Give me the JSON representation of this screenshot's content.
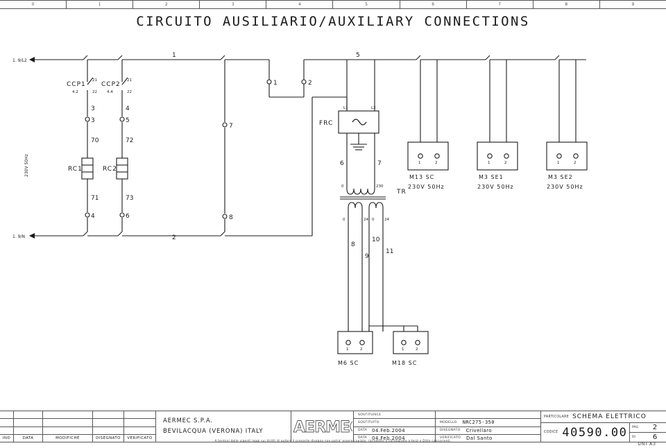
{
  "ruler": {
    "marks": [
      "0",
      "1",
      "2",
      "3",
      "4",
      "5",
      "6",
      "7",
      "8",
      "9"
    ]
  },
  "title": "CIRCUITO AUSILIARIO/AUXILIARY CONNECTIONS",
  "supply": {
    "top_rail_label": "1. 9/L2",
    "bottom_rail_label": "1. 9/N",
    "voltage_label": "230V 50Hz"
  },
  "wires": {
    "top_rail_1": "1",
    "top_rail_5": "5",
    "bottom_rail_2": "2",
    "w3_upper": "3",
    "w3_lower": "3",
    "w4_upper": "4",
    "w5_lower": "5",
    "w70": "70",
    "w72": "72",
    "w71": "71",
    "w73": "73",
    "w4_bottom": "4",
    "w6_bottom": "6",
    "w7_mid": "7",
    "w8_mid": "8",
    "w1_term": "1",
    "w2_term": "2",
    "w6_pri": "6",
    "w7_pri": "7",
    "w8_sec": "8",
    "w9_sec": "9",
    "w10_sec": "10",
    "w11_sec": "11"
  },
  "contactors": [
    {
      "name": "CCP1",
      "ref": "4.2",
      "terminal_top": "21",
      "terminal_bottom": "22"
    },
    {
      "name": "CCP2",
      "ref": "4.4",
      "terminal_top": "21",
      "terminal_bottom": "22"
    }
  ],
  "resistors": [
    {
      "name": "RC1"
    },
    {
      "name": "RC2"
    }
  ],
  "filter": {
    "name": "FRC",
    "input_left": "L1",
    "input_right": "L2"
  },
  "transformer": {
    "name": "TR",
    "primary_left": "0",
    "primary_right": "230",
    "secondary1_left": "0",
    "secondary1_right": "24",
    "secondary2_left": "0",
    "secondary2_right": "24"
  },
  "terminal_blocks": [
    {
      "name": "M13 SC",
      "rating": "230V 50Hz",
      "pins": [
        "1",
        "2"
      ]
    },
    {
      "name": "M3 SE1",
      "rating": "230V 50Hz",
      "pins": [
        "1",
        "2"
      ]
    },
    {
      "name": "M3 SE2",
      "rating": "230V 50Hz",
      "pins": [
        "1",
        "2"
      ]
    },
    {
      "name": "M6 SC",
      "rating": "",
      "pins": [
        "1",
        "2"
      ]
    },
    {
      "name": "M18 SC",
      "rating": "",
      "pins": [
        "1",
        "2"
      ]
    }
  ],
  "title_block": {
    "revision_headers": [
      "IND",
      "DATA",
      "MODIFICHE",
      "DISEGNATO",
      "VERIFICATO"
    ],
    "company_name": "AERMEC S.P.A.",
    "company_address": "BEVILACQUA (VERONA) ITALY",
    "logo_text": "AERMEC",
    "replaces_label": "SOSTITUISCE",
    "replaces_value": "",
    "replaced_label": "SOSTITUITO",
    "replaced_value": "",
    "model_label": "MODELLO",
    "model_value": "NRC275-350",
    "date1_label": "DATA",
    "date1_value": "04.Feb.2004",
    "drawn_label": "DISEGNATO",
    "drawn_value": "Crivellaro",
    "date2_label": "DATA",
    "date2_value": "04.Feb.2004",
    "checked_label": "VERIFICATO",
    "checked_value": "Dal Santo",
    "particular_label": "PARTICOLARE",
    "particular_value": "SCHEMA ELETTRICO",
    "code_label": "CODICE",
    "code_value": "40590.00",
    "page_label": "PAG",
    "page_value": "2",
    "of_label": "DI",
    "of_value": "6",
    "standard": "UNI A3"
  },
  "copyright": "A termini delle vigenti leggi sui diritti di autore il presente disegno non potra' essere copiato, riprodotto o consegnato a terzi o Ditte concorrenti."
}
